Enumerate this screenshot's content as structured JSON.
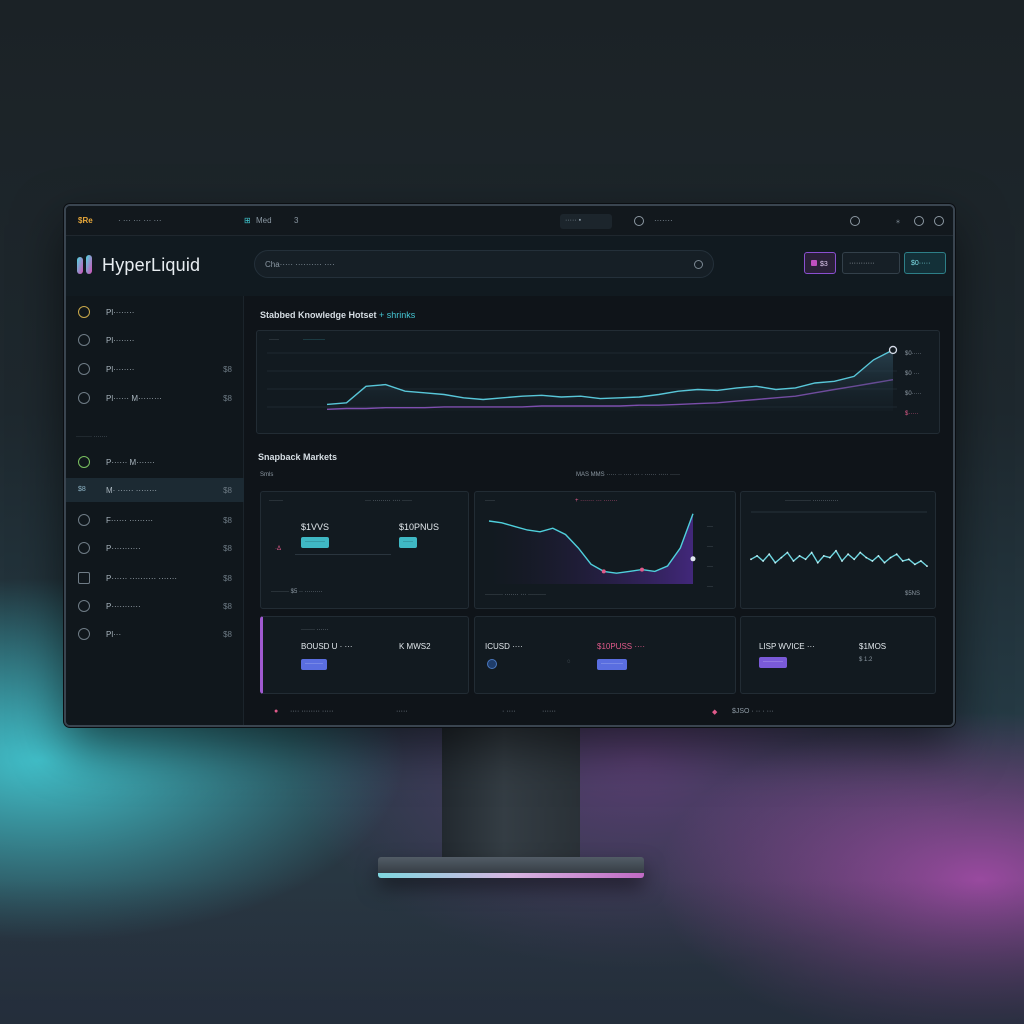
{
  "topbar": {
    "brand_badge": "$Re",
    "menu_a": "· ··· ··· ··· ···",
    "tab_label": "Med",
    "tab_num": "3",
    "search_label": "·····",
    "search_right": "·······"
  },
  "header": {
    "logo_text": "HyperLiquid",
    "search_placeholder": "Cha····· ·········· ····",
    "btn_a": "$3",
    "btn_b": "···········",
    "btn_c": "$0·····"
  },
  "sidebar": {
    "items": [
      {
        "label": "Pl········",
        "count": ""
      },
      {
        "label": "Pl········",
        "count": ""
      },
      {
        "label": "Pl········",
        "count": "$8"
      },
      {
        "label": "Pl······ M·········",
        "count": "$8"
      }
    ],
    "group_label": "········ ·······",
    "items2": [
      {
        "label": "P······ M·······",
        "count": ""
      },
      {
        "label": "M· ······ ········",
        "count": "$8"
      },
      {
        "label": "F······ ·········",
        "count": "$8"
      },
      {
        "label": "P···········",
        "count": "$8"
      },
      {
        "label": "P······ ·········· ·······",
        "count": "$8"
      },
      {
        "label": "P···········",
        "count": "$8"
      },
      {
        "label": "Pl···",
        "count": "$8"
      }
    ]
  },
  "main": {
    "chart_title": "Stabbed Knowledge Hotset",
    "chart_title_accent": "+ shrinks",
    "legend_a": "·····",
    "legend_b": "···········",
    "section2_title": "Snapback Markets",
    "section2_sub": "Smls",
    "section2_filters": "MAS  MMS  ·····  ·· ···· ···  ·  ······  ·····  ·····",
    "card1": {
      "title": "·······",
      "title_r": "··· ········· ···· ·····",
      "v1": "$1VVS",
      "v2": "$10PNUS",
      "chip1": "··········",
      "chip2": "·····",
      "foot": "·········  $5  ·· ·········"
    },
    "card2": {
      "title": "·····",
      "title_r": "+ ······· ··· ·······",
      "foot": "········· ······· ··· ·········"
    },
    "card3": {
      "title": "············· ·············",
      "foot_r": "$5NS"
    },
    "card4": {
      "title": "······· ······",
      "v1": "BOUSD U · ···",
      "v2": "K MWS2",
      "chip": "·········"
    },
    "card5": {
      "v1": "ICUSD ····",
      "v2": "$10PUSS ····",
      "chip": "···········"
    },
    "card6": {
      "v1": "LISP WVICE ···",
      "v2": "$1MOS",
      "v3": "$ 1.2",
      "chip": "··········"
    },
    "footer": [
      "···· ········ ·····",
      "·····",
      "· ····",
      "······",
      "$JSO · ·· · ···"
    ]
  },
  "colors": {
    "accent_cyan": "#45c7d4",
    "accent_purple": "#a05ad0",
    "accent_pink": "#e05a8a",
    "accent_blue": "#5a6ee0"
  },
  "chart_data": [
    {
      "type": "line",
      "series": [
        {
          "values": [
            8,
            10,
            30,
            32,
            24,
            22,
            20,
            16,
            14,
            16,
            18,
            19,
            17,
            18,
            15,
            16,
            17,
            20,
            24,
            26,
            25,
            28,
            30,
            26,
            28,
            34,
            36,
            42,
            62,
            74
          ]
        },
        {
          "values": [
            2,
            3,
            3,
            4,
            4,
            4,
            5,
            5,
            5,
            5,
            5,
            6,
            6,
            6,
            6,
            6,
            7,
            7,
            8,
            9,
            10,
            12,
            14,
            16,
            18,
            22,
            26,
            30,
            34,
            38
          ]
        }
      ]
    },
    {
      "type": "line",
      "series": [
        {
          "values": [
            70,
            68,
            64,
            60,
            58,
            62,
            55,
            40,
            22,
            14,
            12,
            14,
            16,
            14,
            20,
            40,
            78
          ]
        }
      ]
    },
    {
      "type": "line",
      "series": [
        {
          "values": [
            22,
            26,
            20,
            28,
            18,
            24,
            30,
            20,
            26,
            22,
            30,
            18,
            26,
            24,
            32,
            20,
            28,
            22,
            30,
            24,
            20,
            26,
            18,
            24,
            28,
            20,
            22,
            16,
            20,
            14
          ]
        }
      ]
    }
  ]
}
